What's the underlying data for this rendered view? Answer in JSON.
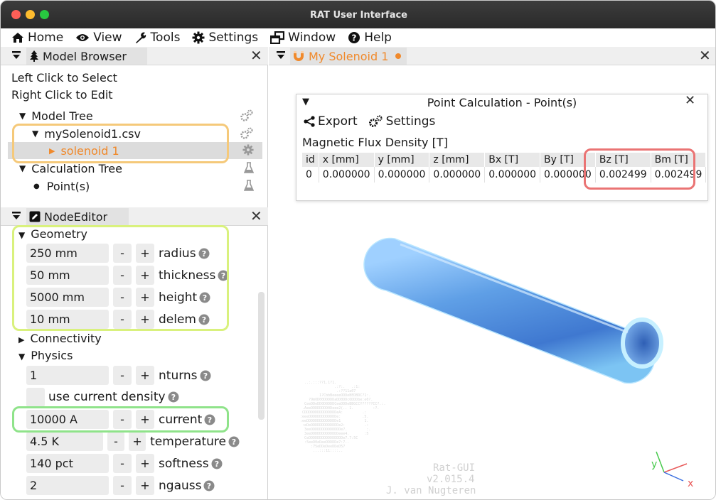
{
  "window": {
    "title": "RAT User Interface"
  },
  "menu": [
    {
      "label": "Home",
      "icon": "home-icon"
    },
    {
      "label": "View",
      "icon": "eye-icon"
    },
    {
      "label": "Tools",
      "icon": "wrench-icon"
    },
    {
      "label": "Settings",
      "icon": "gear-icon"
    },
    {
      "label": "Window",
      "icon": "window-icon"
    },
    {
      "label": "Help",
      "icon": "help-circle-icon"
    }
  ],
  "model_browser": {
    "tab_label": "Model Browser",
    "hint_select": "Left Click to Select",
    "hint_edit": "Right Click to Edit",
    "tree": {
      "model_tree": "Model Tree",
      "csv_node": "mySolenoid1.csv",
      "solenoid_node": "solenoid 1",
      "calc_tree": "Calculation Tree",
      "points_node": "Point(s)"
    }
  },
  "node_editor": {
    "tab_label": "NodeEditor",
    "geometry": {
      "label": "Geometry",
      "fields": [
        {
          "value": "250 mm",
          "label": "radius"
        },
        {
          "value": "50 mm",
          "label": "thickness"
        },
        {
          "value": "5000 mm",
          "label": "height"
        },
        {
          "value": "10 mm",
          "label": "delem"
        }
      ]
    },
    "connectivity": {
      "label": "Connectivity"
    },
    "physics": {
      "label": "Physics",
      "nturns": {
        "value": "1",
        "label": "nturns"
      },
      "use_current_density": "use current density",
      "fields": [
        {
          "value": "10000 A",
          "label": "current"
        },
        {
          "value": "4.5 K",
          "label": "temperature"
        },
        {
          "value": "140 pct",
          "label": "softness"
        },
        {
          "value": "2",
          "label": "ngauss"
        }
      ]
    },
    "minus": "-",
    "plus": "+"
  },
  "document_tab": {
    "label": "My Solenoid 1"
  },
  "point_calc": {
    "title": "Point Calculation - Point(s)",
    "export_label": "Export",
    "settings_label": "Settings",
    "subtitle": "Magnetic Flux Density [T]",
    "columns": [
      "id",
      "x [mm]",
      "y [mm]",
      "z [mm]",
      "Bx [T]",
      "By [T]",
      "Bz [T]",
      "Bm [T]"
    ],
    "rows": [
      [
        "0",
        "0.000000",
        "0.000000",
        "0.000000",
        "0.000000",
        "0.000000",
        "0.002499",
        "0.002499"
      ]
    ]
  },
  "viewport": {
    "axis_y": "y",
    "axis_x": "x",
    "axis_z": "z",
    "watermark_name": "Rat-GUI",
    "watermark_version": "v2.015.4",
    "watermark_author": "J. van Nugteren"
  },
  "colors": {
    "accent_orange": "#f0892b",
    "highlight_orange": "#f5c97a",
    "highlight_lime": "#d9f17d",
    "highlight_green": "#8fe38a",
    "highlight_red": "#ea7474",
    "tube_blue": "#5f9fe6"
  }
}
